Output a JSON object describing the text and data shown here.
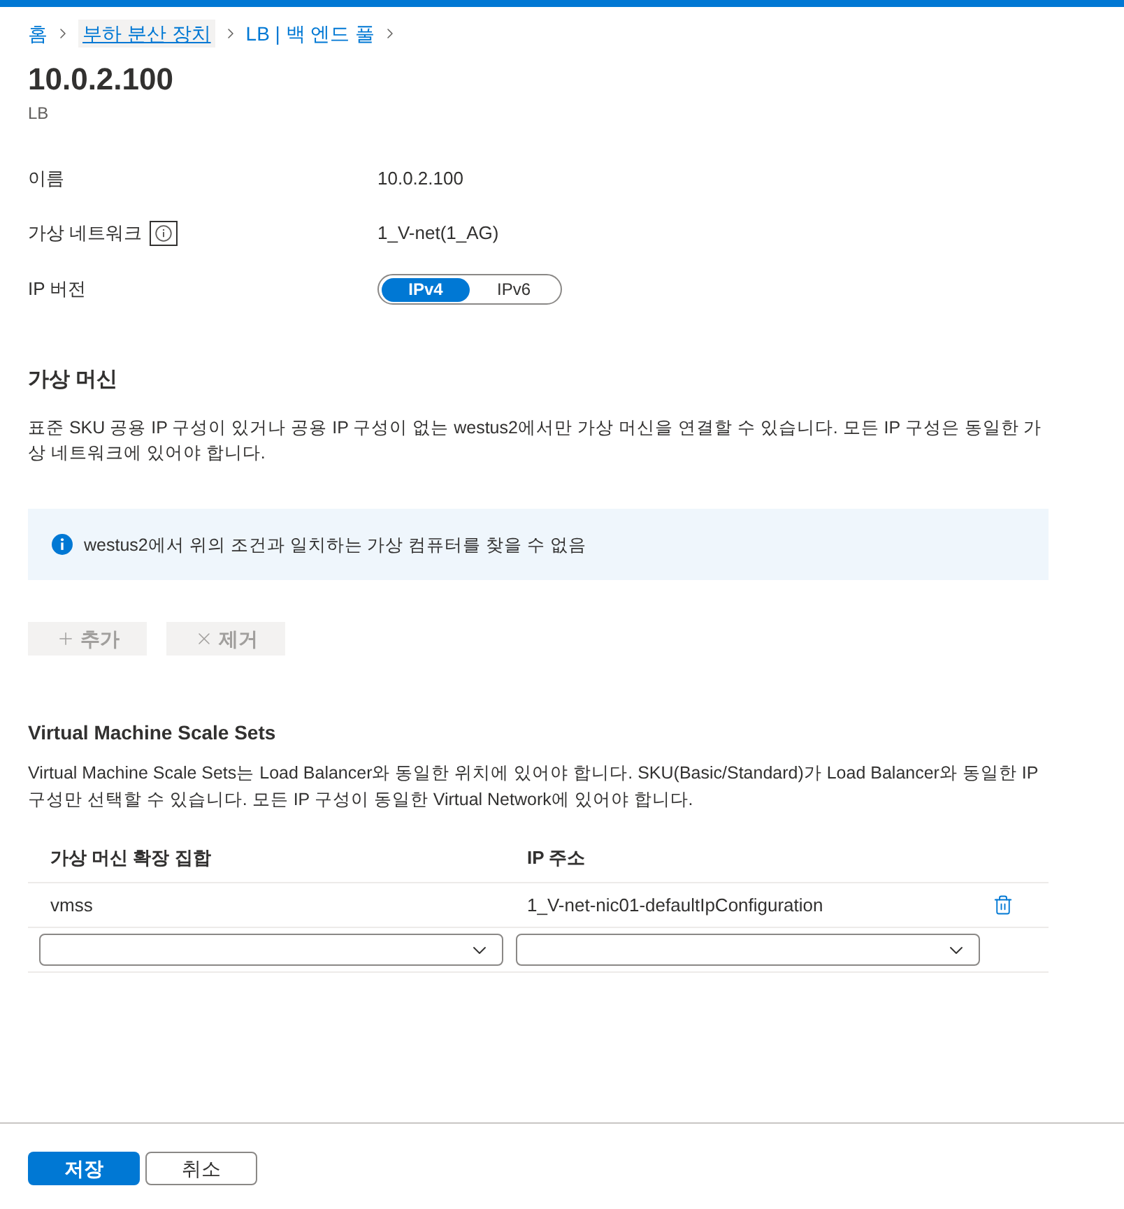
{
  "breadcrumb": [
    {
      "label": "홈",
      "hovered": false
    },
    {
      "label": "부하 분산 장치",
      "hovered": true
    },
    {
      "label": "LB | 백 엔드 풀",
      "hovered": false
    }
  ],
  "header": {
    "title": "10.0.2.100",
    "subtitle": "LB"
  },
  "properties": [
    {
      "kind": "text",
      "label": "이름",
      "info": false,
      "value": "10.0.2.100"
    },
    {
      "kind": "text",
      "label": "가상 네트워크",
      "info": true,
      "value": "1_V-net(1_AG)"
    },
    {
      "kind": "toggle",
      "label": "IP 버전",
      "info": false,
      "options": [
        {
          "label": "IPv4",
          "selected": true
        },
        {
          "label": "IPv6",
          "selected": false
        }
      ]
    }
  ],
  "virtual_machines": {
    "heading": "가상 머신",
    "description": "표준 SKU 공용 IP 구성이 있거나 공용 IP 구성이 없는 westus2에서만 가상 머신을 연결할 수 있습니다. 모든 IP 구성은 동일한 가상 네트워크에 있어야 합니다.",
    "notice": "westus2에서 위의 조건과 일치하는 가상 컴퓨터를 찾을 수 없음",
    "buttons": [
      {
        "kind": "add",
        "label": "추가",
        "disabled": true
      },
      {
        "kind": "remove",
        "label": "제거",
        "disabled": true
      }
    ]
  },
  "scale_sets": {
    "heading": "Virtual Machine Scale Sets",
    "description": "Virtual Machine Scale Sets는 Load Balancer와 동일한 위치에 있어야 합니다. SKU(Basic/Standard)가 Load Balancer와 동일한 IP 구성만 선택할 수 있습니다. 모든 IP 구성이 동일한 Virtual Network에 있어야 합니다.",
    "columns": [
      "가상 머신 확장 집합",
      "IP 주소"
    ],
    "rows": [
      {
        "kind": "item",
        "cells": [
          "vmss",
          "1_V-net-nic01-defaultIpConfiguration"
        ],
        "deletable": true
      },
      {
        "kind": "entry"
      }
    ]
  },
  "footer": {
    "buttons": [
      {
        "kind": "primary",
        "label": "저장"
      },
      {
        "kind": "secondary",
        "label": "취소"
      }
    ]
  }
}
